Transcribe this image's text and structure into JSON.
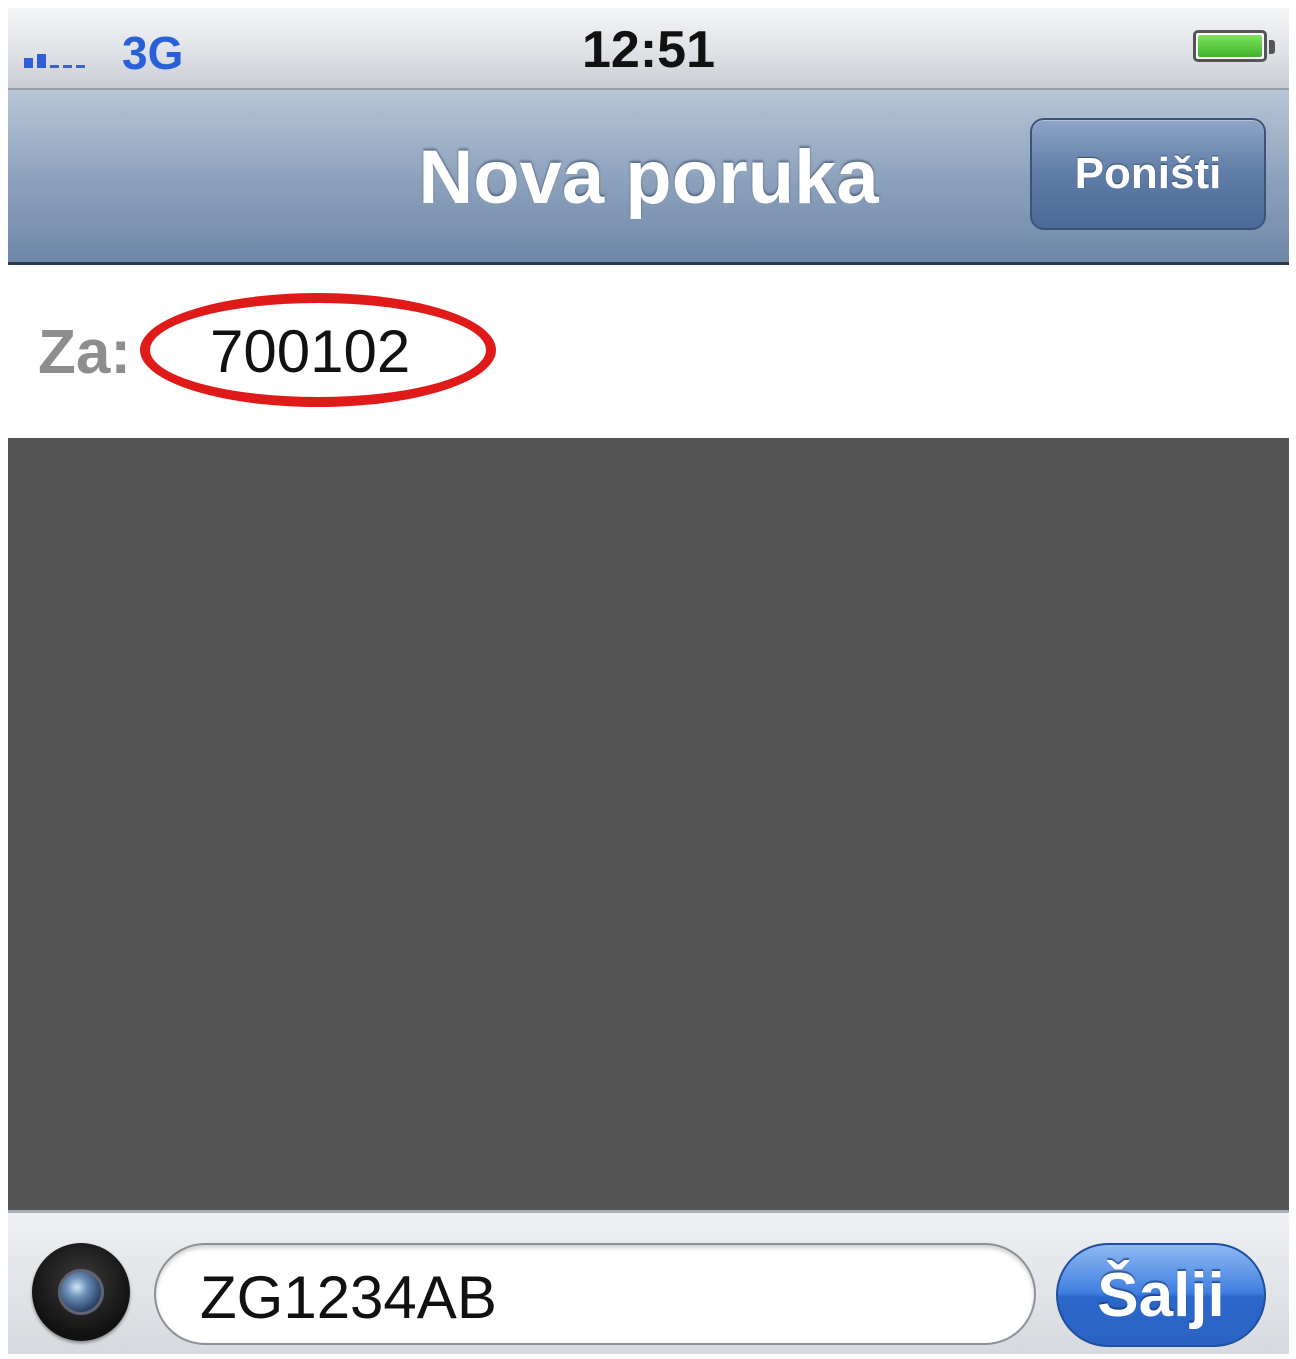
{
  "status_bar": {
    "network": "3G",
    "time": "12:51",
    "battery_level": 1.0,
    "signal_bars": 2,
    "signal_icon": "signal-strength-icon",
    "battery_icon": "battery-icon"
  },
  "nav": {
    "title": "Nova poruka",
    "cancel_label": "Poništi"
  },
  "recipient": {
    "label": "Za:",
    "value": "700102"
  },
  "compose": {
    "camera_icon": "camera-icon",
    "message_value": "ZG1234AB",
    "send_label": "Šalji"
  },
  "colors": {
    "highlight": "#e01919",
    "network_text": "#2960d9",
    "send_button": "#2b66c9",
    "content_area": "#555555"
  }
}
